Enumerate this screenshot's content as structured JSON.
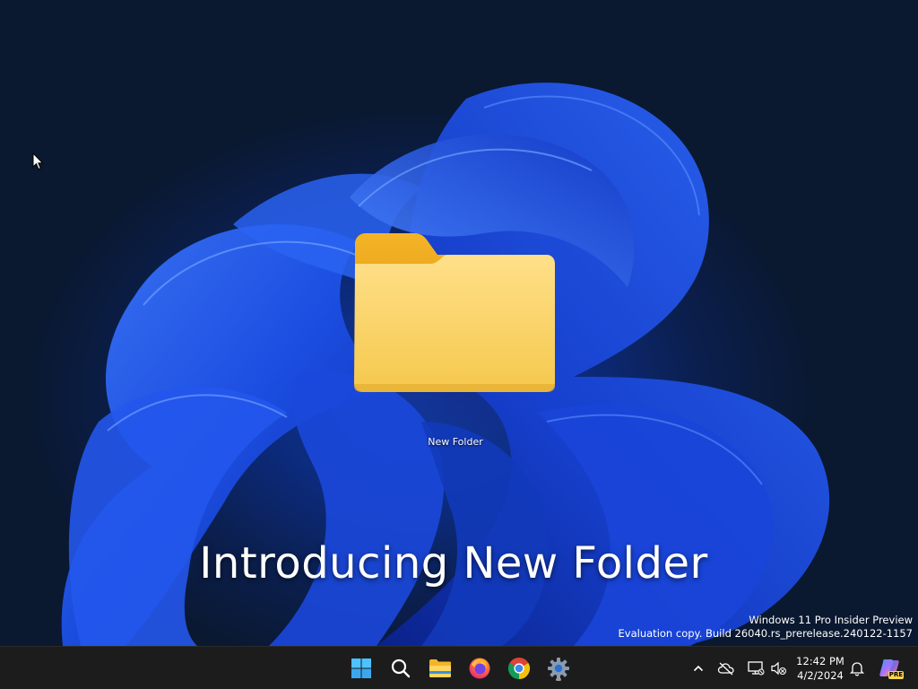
{
  "desktop": {
    "icon_label": "New Folder",
    "headline": "Introducing New Folder",
    "watermark_line1": "Windows 11 Pro Insider Preview",
    "watermark_line2": "Evaluation copy. Build 26040.rs_prerelease.240122-1157"
  },
  "taskbar": {
    "apps": [
      {
        "name": "start",
        "icon": "windows-logo-icon"
      },
      {
        "name": "search",
        "icon": "search-icon"
      },
      {
        "name": "file-explorer",
        "icon": "folder-icon"
      },
      {
        "name": "firefox",
        "icon": "firefox-icon"
      },
      {
        "name": "chrome",
        "icon": "chrome-icon"
      },
      {
        "name": "settings",
        "icon": "gear-icon"
      }
    ],
    "tray": {
      "icons": [
        "chevron-up-icon",
        "cloud-offline-icon",
        "network-icon",
        "speaker-muted-icon"
      ],
      "time": "12:42 PM",
      "date": "4/2/2024",
      "copilot_badge": "PRE"
    }
  },
  "colors": {
    "taskbar_bg": "#1c1c1c",
    "wallpaper_blue": "#1f4fe0",
    "folder_yellow": "#f7c744"
  }
}
